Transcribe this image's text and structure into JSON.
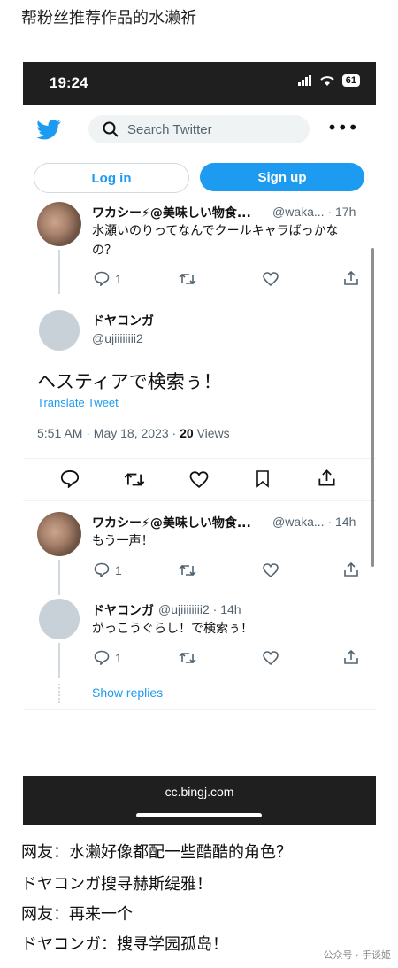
{
  "header_title": "帮粉丝推荐作品的水濑祈",
  "status": {
    "time": "19:24",
    "battery": "61"
  },
  "search_placeholder": "Search Twitter",
  "buttons": {
    "login": "Log in",
    "signup": "Sign up"
  },
  "tweet1": {
    "name": "ワカシー⚡@美味しい物食...",
    "handle": "@waka... · 17h",
    "text_l1": "水瀬いのりってなんでクールキャラばっかな",
    "text_l2": "の？",
    "replies": "1"
  },
  "main": {
    "name": "ドヤコンガ",
    "handle": "@ujiiiiiiii2",
    "text": "ヘスティアで検索ぅ！",
    "translate": "Translate Tweet",
    "time": "5:51 AM · May 18, 2023 · ",
    "views_count": "20",
    "views_label": " Views"
  },
  "tweet2": {
    "name": "ワカシー⚡@美味しい物食...",
    "handle": "@waka... · 14h",
    "text": "もう一声！",
    "replies": "1"
  },
  "tweet3": {
    "name": "ドヤコンガ",
    "handle": "@ujiiiiiiii2 · 14h",
    "text": "がっこうぐらし！で検索ぅ！",
    "replies": "1"
  },
  "show_replies": "Show replies",
  "footer_url": "cc.bingj.com",
  "captions": [
    "网友：水濑好像都配一些酷酷的角色？",
    "ドヤコンガ搜寻赫斯缇雅！",
    "网友：再来一个",
    "ドヤコンガ：搜寻学园孤岛！"
  ],
  "watermark": "公众号 · 手谈姬",
  "colors": {
    "accent": "#1d9bf0",
    "dark_bar": "#1f1f1f",
    "muted": "#536471"
  }
}
